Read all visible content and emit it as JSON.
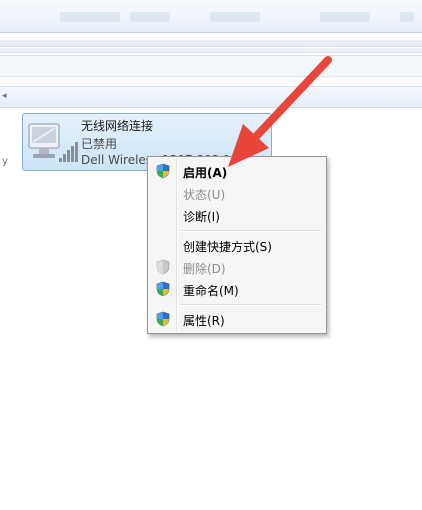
{
  "adapter": {
    "name": "无线网络连接",
    "status": "已禁用",
    "device": "Dell Wireless 1397 802.11",
    "icon": "wireless-adapter-icon"
  },
  "context_menu": {
    "items": [
      {
        "label": "启用(A)",
        "bold": true,
        "disabled": false,
        "shield": true
      },
      {
        "label": "状态(U)",
        "bold": false,
        "disabled": true,
        "shield": false
      },
      {
        "label": "诊断(I)",
        "bold": false,
        "disabled": false,
        "shield": false
      },
      {
        "label": "创建快捷方式(S)",
        "bold": false,
        "disabled": false,
        "shield": false
      },
      {
        "label": "删除(D)",
        "bold": false,
        "disabled": true,
        "shield": true
      },
      {
        "label": "重命名(M)",
        "bold": false,
        "disabled": false,
        "shield": true
      },
      {
        "label": "属性(R)",
        "bold": false,
        "disabled": false,
        "shield": true
      }
    ]
  },
  "colors": {
    "selection_fill": "#cde4f7",
    "selection_border": "#84acdd",
    "arrow": "#e8463a",
    "menu_bg": "#f5f5f5"
  }
}
